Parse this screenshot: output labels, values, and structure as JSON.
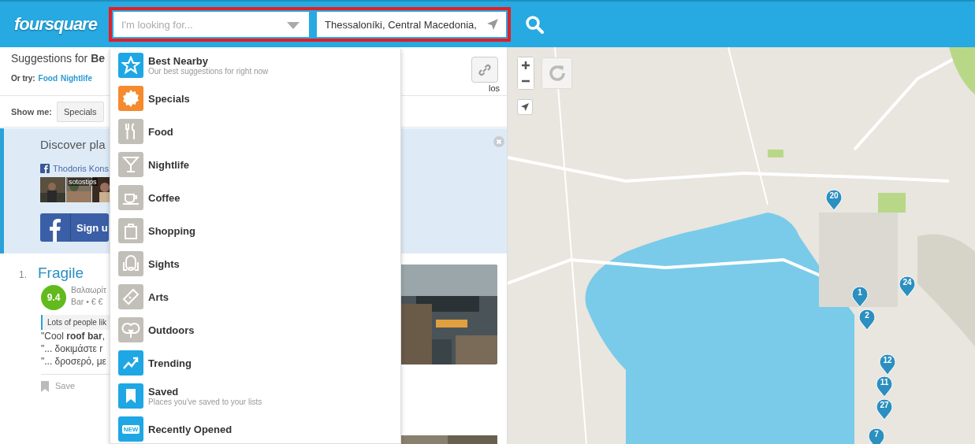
{
  "header": {
    "logo": "foursquare",
    "search": {
      "placeholder": "I'm looking for..."
    },
    "location": {
      "value": "Thessaloníki, Central Macedonia, "
    }
  },
  "panel": {
    "title_prefix": "Suggestions for ",
    "title_cut": "Be",
    "or_try": "Or try:",
    "links": [
      "Food",
      "Nightlife"
    ],
    "show_me": "Show me:",
    "filter": "Specials",
    "partial": "los"
  },
  "discover": {
    "title": "Discover pla",
    "friend": "Thodoris Kons",
    "photo_caption": "sotostips",
    "signup": "Sign u"
  },
  "result": {
    "rank": "1.",
    "name": "Fragile",
    "score": "9.4",
    "address": "Βαλαωρίτ",
    "category": "Bar • € €",
    "tip": "Lots of people lik",
    "quotes": [
      "\"Cool **roof bar**,",
      "\"... δοκιμάστε r",
      "\"... δροσερό, με"
    ],
    "save": "Save"
  },
  "dropdown": [
    {
      "label": "Best Nearby",
      "sub": "Our best suggestions for right now",
      "kind": "star",
      "color": "#1ea7e4"
    },
    {
      "label": "Specials",
      "kind": "badge",
      "color": "#f58a2e"
    },
    {
      "label": "Food",
      "kind": "fork",
      "color": "#c1bfb8"
    },
    {
      "label": "Nightlife",
      "kind": "glass",
      "color": "#c1bfb8"
    },
    {
      "label": "Coffee",
      "kind": "cup",
      "color": "#c1bfb8"
    },
    {
      "label": "Shopping",
      "kind": "bag",
      "color": "#c1bfb8"
    },
    {
      "label": "Sights",
      "kind": "face",
      "color": "#c1bfb8"
    },
    {
      "label": "Arts",
      "kind": "ticket",
      "color": "#c1bfb8"
    },
    {
      "label": "Outdoors",
      "kind": "tree",
      "color": "#c1bfb8"
    },
    {
      "label": "Trending",
      "kind": "trend",
      "color": "#1ea7e4"
    },
    {
      "label": "Saved",
      "sub": "Places you've saved to your lists",
      "kind": "bookmark",
      "color": "#1ea7e4"
    },
    {
      "label": "Recently Opened",
      "kind": "new",
      "badge": "NEW",
      "color": "#1ea7e4"
    }
  ],
  "map": {
    "pins": [
      "20",
      "24",
      "1",
      "2",
      "12",
      "11",
      "27",
      "7"
    ]
  }
}
